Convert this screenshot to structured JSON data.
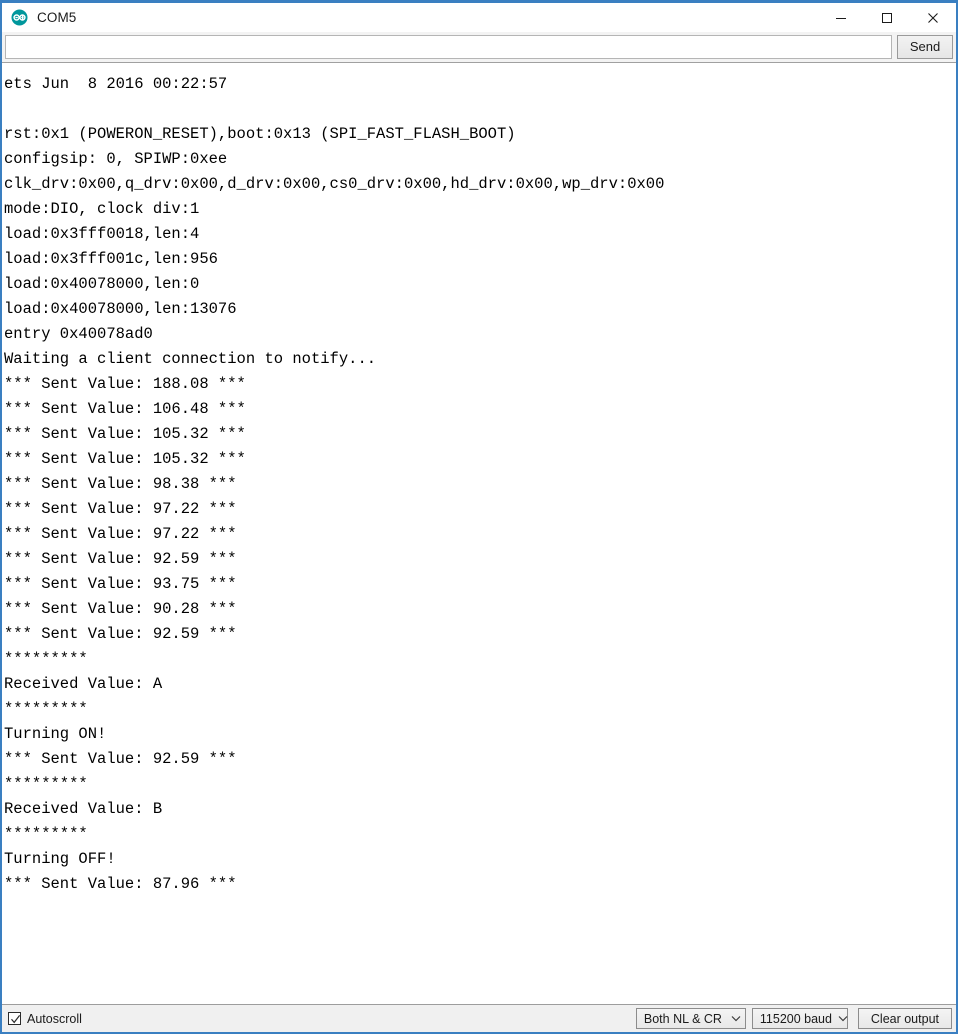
{
  "window": {
    "title": "COM5",
    "app_icon": "arduino-logo-icon",
    "accent_color": "#3a7fc1",
    "controls": [
      {
        "name": "minimize",
        "glyph": "minimize-icon"
      },
      {
        "name": "maximize",
        "glyph": "maximize-icon"
      },
      {
        "name": "close",
        "glyph": "close-icon"
      }
    ]
  },
  "send_bar": {
    "input_value": "",
    "input_placeholder": "",
    "send_label": "Send"
  },
  "console": {
    "lines": [
      "ets Jun  8 2016 00:22:57",
      "",
      "rst:0x1 (POWERON_RESET),boot:0x13 (SPI_FAST_FLASH_BOOT)",
      "configsip: 0, SPIWP:0xee",
      "clk_drv:0x00,q_drv:0x00,d_drv:0x00,cs0_drv:0x00,hd_drv:0x00,wp_drv:0x00",
      "mode:DIO, clock div:1",
      "load:0x3fff0018,len:4",
      "load:0x3fff001c,len:956",
      "load:0x40078000,len:0",
      "load:0x40078000,len:13076",
      "entry 0x40078ad0",
      "Waiting a client connection to notify...",
      "*** Sent Value: 188.08 ***",
      "*** Sent Value: 106.48 ***",
      "*** Sent Value: 105.32 ***",
      "*** Sent Value: 105.32 ***",
      "*** Sent Value: 98.38 ***",
      "*** Sent Value: 97.22 ***",
      "*** Sent Value: 97.22 ***",
      "*** Sent Value: 92.59 ***",
      "*** Sent Value: 93.75 ***",
      "*** Sent Value: 90.28 ***",
      "*** Sent Value: 92.59 ***",
      "*********",
      "Received Value: A",
      "*********",
      "Turning ON!",
      "*** Sent Value: 92.59 ***",
      "*********",
      "Received Value: B",
      "*********",
      "Turning OFF!",
      "*** Sent Value: 87.96 ***"
    ]
  },
  "bottom_bar": {
    "autoscroll_label": "Autoscroll",
    "autoscroll_checked": true,
    "ghost_text": "",
    "line_ending": "Both NL & CR",
    "baud_rate": "115200 baud",
    "clear_output_label": "Clear output"
  }
}
